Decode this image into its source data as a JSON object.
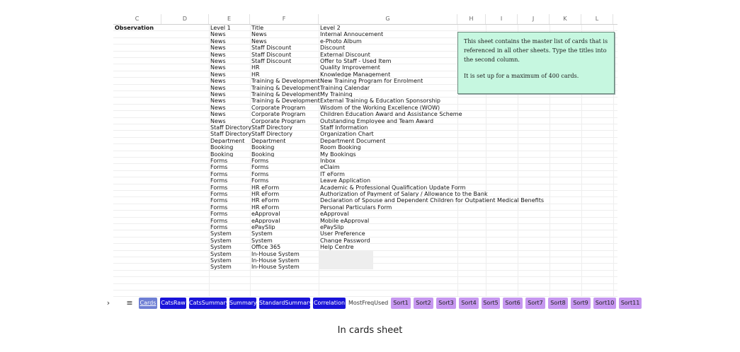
{
  "columns": [
    "C",
    "D",
    "E",
    "F",
    "G",
    "H",
    "I",
    "J",
    "K",
    "L"
  ],
  "header_row": {
    "observation": "Observation",
    "level1": "Level 1",
    "title": "Title",
    "level2": "Level 2"
  },
  "rows": [
    [
      "News",
      "News",
      "Internal Annoucement"
    ],
    [
      "News",
      "News",
      "e-Photo Album"
    ],
    [
      "News",
      "Staff Discount",
      "        Discount"
    ],
    [
      "News",
      "Staff Discount",
      "External Discount"
    ],
    [
      "News",
      "Staff Discount",
      "Offer to Staff - Used Item"
    ],
    [
      "News",
      "HR",
      "Quality Improvement"
    ],
    [
      "News",
      "HR",
      "Knowledge Management"
    ],
    [
      "News",
      "Training & Development",
      "New Training Program for Enrolment"
    ],
    [
      "News",
      "Training & Development",
      "Training Calendar"
    ],
    [
      "News",
      "Training & Development",
      "My Training"
    ],
    [
      "News",
      "Training & Development",
      "External Training & Education Sponsorship"
    ],
    [
      "News",
      "Corporate Program",
      "Wisdom of the Working Excellence (WOW)"
    ],
    [
      "News",
      "Corporate Program",
      "Children Education Award and Assistance Scheme"
    ],
    [
      "News",
      "Corporate Program",
      "Outstanding Employee and Team Award"
    ],
    [
      "Staff Directory",
      "Staff Directory",
      "Staff Information"
    ],
    [
      "Staff Directory",
      "Staff Directory",
      "Organization Chart"
    ],
    [
      "Department",
      "Department",
      "Department Document"
    ],
    [
      "Booking",
      "Booking",
      "Room Booking"
    ],
    [
      "Booking",
      "Booking",
      "My Bookings"
    ],
    [
      "Forms",
      "Forms",
      "Inbox"
    ],
    [
      "Forms",
      "Forms",
      "eClaim"
    ],
    [
      "Forms",
      "Forms",
      "IT eForm"
    ],
    [
      "Forms",
      "Forms",
      "Leave Application"
    ],
    [
      "Forms",
      "HR eForm",
      "Academic & Professional Qualification Update Form"
    ],
    [
      "Forms",
      "HR eForm",
      "Authorization of Payment of Salary / Allowance to the Bank"
    ],
    [
      "Forms",
      "HR eForm",
      "Declaration of Spouse and Dependent Children for Outpatient Medical Benefits"
    ],
    [
      "Forms",
      "HR eForm",
      "Personal Particulars Form"
    ],
    [
      "Forms",
      "eApproval",
      "eApproval"
    ],
    [
      "Forms",
      "eApproval",
      "Mobile eApproval"
    ],
    [
      "Forms",
      "ePaySlip",
      "ePaySlip"
    ],
    [
      "System",
      "System",
      "User Preference"
    ],
    [
      "System",
      "System",
      "Change Password"
    ],
    [
      "System",
      "Office 365",
      "Help Centre"
    ],
    [
      "System",
      "In-House System",
      ""
    ],
    [
      "System",
      "In-House System",
      ""
    ],
    [
      "System",
      "In-House System",
      ""
    ]
  ],
  "note": {
    "line1": "This sheet contains the master list of cards that is referenced in all other sheets. Type the titles into the second column.",
    "line2": "It is set up for a maximum of 400 cards."
  },
  "tabs": [
    "Cards",
    "CatsRaw",
    "CatsSummary",
    "Summary",
    "StandardSummary",
    "Correlation",
    "MostFreqUsed",
    "Sort1",
    "Sort2",
    "Sort3",
    "Sort4",
    "Sort5",
    "Sort6",
    "Sort7",
    "Sort8",
    "Sort9",
    "Sort10",
    "Sort11"
  ],
  "nav": {
    "prev": "›",
    "menu": "≡"
  },
  "caption": "In cards sheet"
}
